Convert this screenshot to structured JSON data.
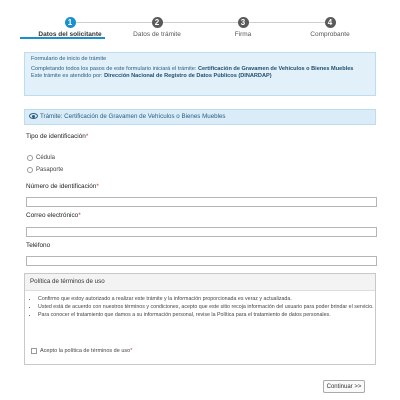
{
  "stepper": {
    "steps": [
      {
        "number": "1",
        "label": "Datos del solicitante"
      },
      {
        "number": "2",
        "label": "Datos de trámite"
      },
      {
        "number": "3",
        "label": "Firma"
      },
      {
        "number": "4",
        "label": "Comprobante"
      }
    ],
    "active_step": 1
  },
  "info": {
    "title": "Formulario de inicio de trámite",
    "line1_prefix": "Completando todos los pasos de este formulario iniciará el trámite:",
    "line1_bold": "Certificación de Gravamen de Vehículos o Bienes Muebles",
    "line2_prefix": "Este trámite es atendido por:",
    "line2_bold": "Dirección Nacional de Registro de Datos Públicos (DINARDAP)"
  },
  "section": {
    "title": "Trámite: Certificación de Gravamen de Vehículos o Bienes Muebles"
  },
  "form": {
    "id_type_label": "Tipo de identificación",
    "options": [
      "Cédula",
      "Pasaporte"
    ],
    "id_number_label": "Número de identificación",
    "email_label": "Correo electrónico",
    "phone_label": "Teléfono",
    "required_mark": "*"
  },
  "terms": {
    "title": "Política de términos de uso",
    "items": [
      "Confirmo que estoy autorizado a realizar este trámite y la información proporcionada es veraz y actualizada.",
      "Usted está de acuerdo con nuestros términos y condiciones, acepto que este sitio recoja información del usuario para poder brindar el servicio.",
      "Para conocer el tratamiento que damos a su información personal, revise la Política para el tratamiento de datos personales."
    ],
    "accept_label": "Acepto la política de términos de uso"
  },
  "buttons": {
    "continue": "Continuar >>"
  },
  "colors": {
    "accent": "#1a8fd0",
    "info_bg": "#e2f0fa"
  }
}
